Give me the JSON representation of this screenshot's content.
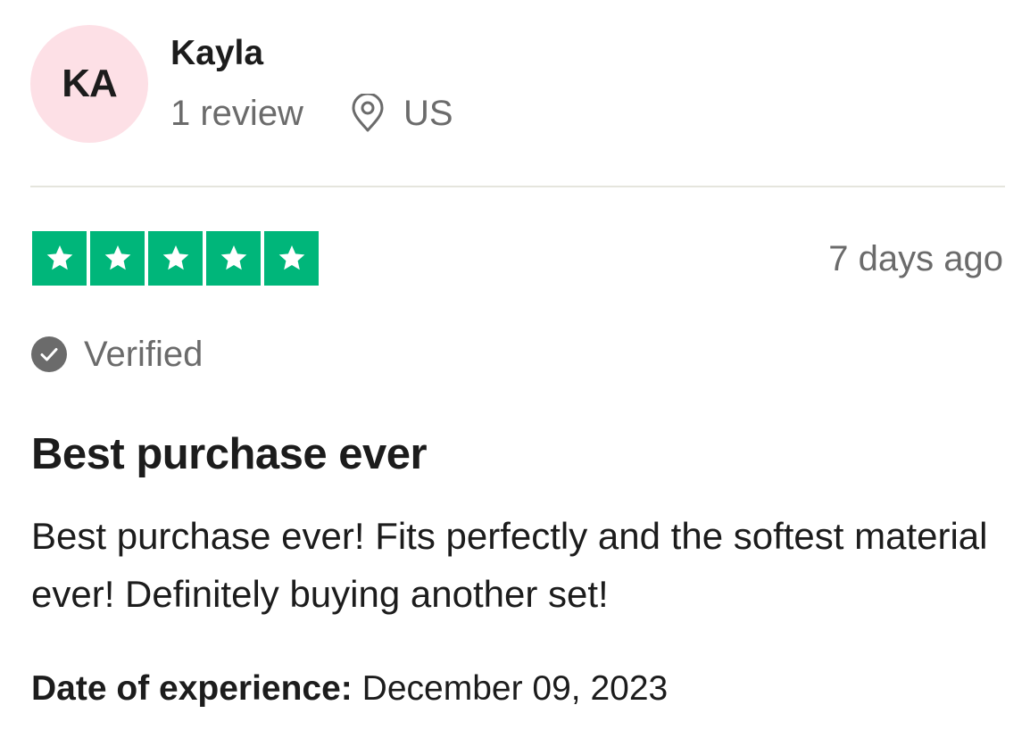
{
  "reviewer": {
    "initials": "KA",
    "avatar_color": "#fde0e6",
    "name": "Kayla",
    "review_count": "1 review",
    "location_icon": "map-pin-icon",
    "country": "US"
  },
  "review": {
    "rating": 5,
    "rating_max": 5,
    "star_color": "#00b67a",
    "date_relative": "7 days ago",
    "verified_icon": "check-circle-icon",
    "verified_label": "Verified",
    "title": "Best purchase ever",
    "body": "Best purchase ever! Fits perfectly and the softest material ever! Definitely buying another set!",
    "experience_label": "Date of experience:",
    "experience_date": "December 09, 2023"
  }
}
